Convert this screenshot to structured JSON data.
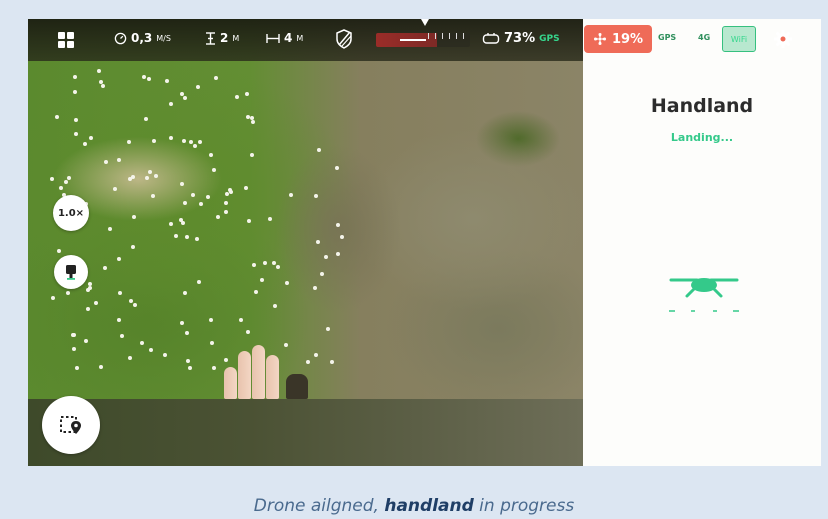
{
  "topbar": {
    "speed_value": "0,3",
    "speed_unit": "M/S",
    "altitude_value": "2",
    "altitude_unit": "M",
    "distance_value": "4",
    "distance_unit": "M",
    "controller_battery": "73%",
    "gps_label": "GPS",
    "drone_battery": "19%",
    "signal_dim_1": "GPS",
    "signal_dim_2": "4G",
    "signal_box": "WiFi",
    "icons": [
      "grid-menu-icon",
      "speedometer-icon",
      "altitude-icon",
      "distance-icon",
      "obstacle-shield-icon",
      "horizon-indicator-icon",
      "controller-icon",
      "fan-icon",
      "settings-gear-icon"
    ]
  },
  "panel": {
    "title": "Handland",
    "status": "Landing...",
    "accent_color": "#34c98a"
  },
  "controls": {
    "zoom_label": "1.0×"
  },
  "caption": {
    "prefix": "Drone ailgned, ",
    "bold": "handland",
    "suffix": " in progress"
  }
}
